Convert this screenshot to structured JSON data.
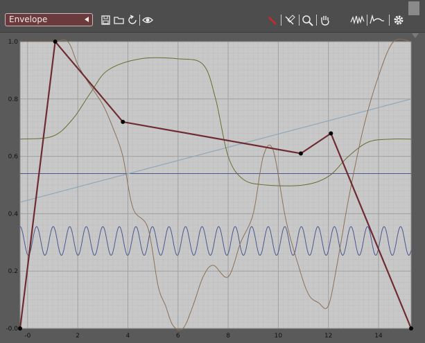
{
  "toolbar": {
    "mode_label": "Envelope",
    "icons": [
      "save-icon",
      "open-folder-icon",
      "undo-icon",
      "eye-icon",
      "pencil-icon",
      "line-draw-icon",
      "zoom-icon",
      "hand-pan-icon",
      "waveform-noise-icon",
      "waveform-step-icon",
      "gear-icon"
    ]
  },
  "colors": {
    "envelope": "#6e2b31",
    "sine": "#4a5592",
    "horizontal_line": "#4a5592",
    "diagonal_line": "#8fa8b8",
    "smooth_curve": "#6b6b2e",
    "noise_curve": "#8b7055",
    "background": "#c8c8c8",
    "grid_major": "#a0a0a0",
    "grid_minor": "#bdbdbd"
  },
  "chart_data": {
    "type": "line",
    "xlim": [
      -0.3,
      15.3
    ],
    "ylim": [
      -0.0,
      1.0
    ],
    "x_ticks": [
      "-0",
      "2",
      "4",
      "6",
      "8",
      "10",
      "12",
      "14"
    ],
    "y_ticks": [
      "-0.0",
      "0.2",
      "0.4",
      "0.6",
      "0.8",
      "1.0"
    ],
    "grid": true,
    "series": [
      {
        "kind": "envelope",
        "x": [
          -0.3,
          1.1,
          3.8,
          10.9,
          12.1,
          15.3
        ],
        "y": [
          0.0,
          1.0,
          0.72,
          0.61,
          0.68,
          0.0
        ]
      },
      {
        "kind": "sine",
        "center": 0.305,
        "amplitude": 0.05,
        "period": 0.66,
        "phase": 0.0
      },
      {
        "kind": "horizontal",
        "y": 0.54
      },
      {
        "kind": "diagonal",
        "x": [
          -0.3,
          15.3
        ],
        "y": [
          0.44,
          0.8
        ]
      },
      {
        "kind": "smooth",
        "x": [
          -0.3,
          1.0,
          1.8,
          2.5,
          3.2,
          4.5,
          6.0,
          7.0,
          7.5,
          8.0,
          8.6,
          9.5,
          11.0,
          12.0,
          12.8,
          13.6,
          14.5,
          15.3
        ],
        "y": [
          0.66,
          0.67,
          0.73,
          0.82,
          0.9,
          0.94,
          0.94,
          0.92,
          0.8,
          0.6,
          0.52,
          0.5,
          0.5,
          0.53,
          0.6,
          0.65,
          0.66,
          0.66
        ]
      },
      {
        "kind": "noise",
        "x": [
          -0.3,
          1.0,
          1.6,
          2.0,
          2.4,
          3.0,
          3.4,
          3.8,
          4.2,
          4.8,
          5.2,
          5.5,
          5.8,
          6.2,
          6.6,
          7.0,
          7.4,
          8.0,
          8.5,
          9.0,
          9.4,
          9.8,
          10.3,
          10.8,
          11.2,
          11.6,
          12.0,
          12.4,
          12.8,
          13.4,
          14.0,
          14.6,
          15.3
        ],
        "y": [
          1.0,
          1.0,
          1.0,
          0.92,
          0.86,
          0.78,
          0.7,
          0.6,
          0.42,
          0.35,
          0.15,
          0.08,
          0.01,
          0.0,
          0.08,
          0.18,
          0.22,
          0.18,
          0.3,
          0.4,
          0.6,
          0.62,
          0.38,
          0.22,
          0.12,
          0.09,
          0.08,
          0.25,
          0.45,
          0.7,
          0.88,
          1.0,
          1.0
        ]
      }
    ]
  }
}
